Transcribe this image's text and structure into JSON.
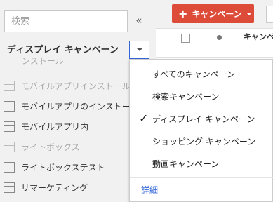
{
  "sidebar": {
    "search_placeholder": "検索",
    "collapse_label": "«",
    "title": "ディスプレイ キャンペーン",
    "cutoff_item": "ンストール",
    "items": [
      {
        "label": "モバイルアプリインストール"
      },
      {
        "label": "モバイルアプリのインストー"
      },
      {
        "label": "モバイルアプリ内"
      },
      {
        "label": "ライトボックス"
      },
      {
        "label": "ライトボックステスト"
      },
      {
        "label": "リマーケティング"
      }
    ]
  },
  "toolbar": {
    "campaign_button_label": "キャンペーン",
    "campaign_button_plus": "+"
  },
  "table": {
    "column_header": "キャンペ"
  },
  "dropdown": {
    "items": [
      {
        "label": "すべてのキャンペーン",
        "selected": false
      },
      {
        "label": "検索キャンペーン",
        "selected": false
      },
      {
        "label": "ディスプレイ キャンペーン",
        "selected": true
      },
      {
        "label": "ショッピング キャンペーン",
        "selected": false
      },
      {
        "label": "動画キャンペーン",
        "selected": false
      }
    ],
    "check_glyph": "✓",
    "details_link": "詳細"
  },
  "colors": {
    "accent_red": "#dd4b39",
    "link_blue": "#3367d6",
    "panel_bg": "#f1f1f1"
  }
}
